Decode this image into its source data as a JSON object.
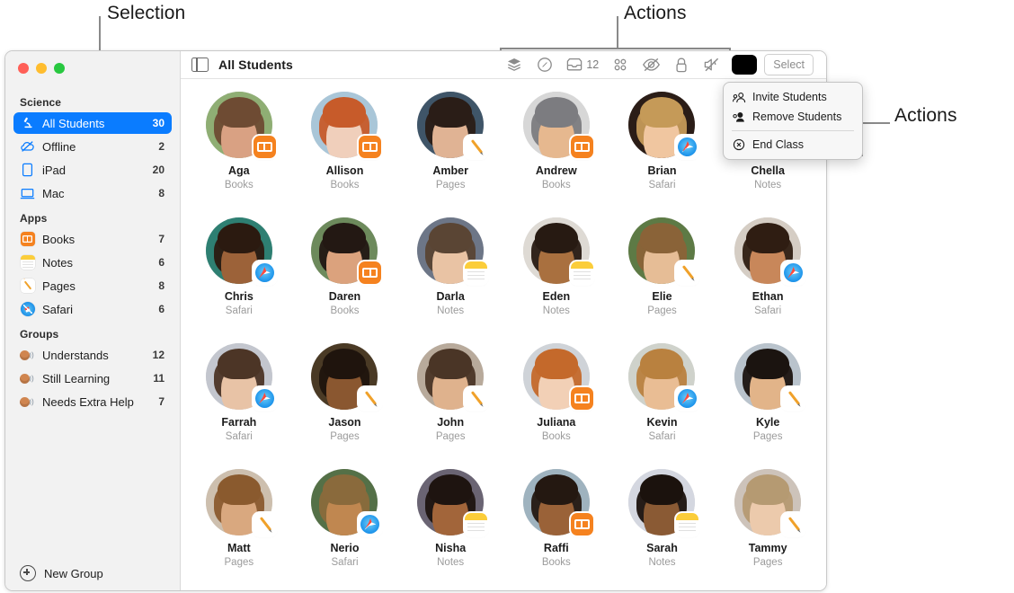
{
  "annotations": [
    {
      "id": "selection",
      "label": "Selection"
    },
    {
      "id": "actions_top",
      "label": "Actions"
    },
    {
      "id": "actions_right",
      "label": "Actions"
    }
  ],
  "window": {
    "traffic_lights": [
      "close",
      "minimize",
      "zoom"
    ],
    "toolbar": {
      "sidebar_toggle_icon": "sidebar-toggle-icon",
      "title": "All Students",
      "icons": [
        {
          "name": "layers-icon",
          "label": "Layers"
        },
        {
          "name": "navigate-icon",
          "label": "Navigate"
        },
        {
          "name": "inbox-icon",
          "label": "Inbox",
          "count": "12"
        },
        {
          "name": "grid-apps-icon",
          "label": "Apps"
        },
        {
          "name": "hide-screen-icon",
          "label": "Hide Screen"
        },
        {
          "name": "lock-icon",
          "label": "Lock"
        },
        {
          "name": "mute-icon",
          "label": "Mute"
        }
      ],
      "color_swatch": "#000000",
      "select_label": "Select"
    }
  },
  "sidebar": {
    "sections": [
      {
        "title": "Science",
        "items": [
          {
            "label": "All Students",
            "count": "30",
            "icon": "microscope-icon",
            "selected": true
          },
          {
            "label": "Offline",
            "count": "2",
            "icon": "offline-cloud-icon",
            "selected": false
          },
          {
            "label": "iPad",
            "count": "20",
            "icon": "ipad-icon",
            "selected": false
          },
          {
            "label": "Mac",
            "count": "8",
            "icon": "mac-icon",
            "selected": false
          }
        ]
      },
      {
        "title": "Apps",
        "items": [
          {
            "label": "Books",
            "count": "7",
            "icon": "books-app-icon",
            "selected": false
          },
          {
            "label": "Notes",
            "count": "6",
            "icon": "notes-app-icon",
            "selected": false
          },
          {
            "label": "Pages",
            "count": "8",
            "icon": "pages-app-icon",
            "selected": false
          },
          {
            "label": "Safari",
            "count": "6",
            "icon": "safari-app-icon",
            "selected": false
          }
        ]
      },
      {
        "title": "Groups",
        "items": [
          {
            "label": "Understands",
            "count": "12",
            "icon": "group-icon",
            "selected": false
          },
          {
            "label": "Still Learning",
            "count": "11",
            "icon": "group-icon",
            "selected": false
          },
          {
            "label": "Needs Extra Help",
            "count": "7",
            "icon": "group-icon",
            "selected": false
          }
        ]
      }
    ],
    "new_group_label": "New Group"
  },
  "actions_menu": {
    "items": [
      {
        "label": "Invite Students",
        "icon": "invite-person-icon"
      },
      {
        "label": "Remove Students",
        "icon": "remove-person-icon"
      },
      {
        "label": "End Class",
        "icon": "end-class-icon"
      }
    ]
  },
  "students": [
    {
      "name": "Aga",
      "app": "Books",
      "badge": "b-books",
      "skin": "#d9a183",
      "hair": "#6e4b33",
      "bg": "#8fae74"
    },
    {
      "name": "Allison",
      "app": "Books",
      "badge": "b-books",
      "skin": "#f0cfbb",
      "hair": "#c75b2a",
      "bg": "#a9c6d8"
    },
    {
      "name": "Amber",
      "app": "Pages",
      "badge": "b-pages",
      "skin": "#e0b394",
      "hair": "#2a1d17",
      "bg": "#3f5568"
    },
    {
      "name": "Andrew",
      "app": "Books",
      "badge": "b-books",
      "skin": "#e6b88f",
      "hair": "#7c7c80",
      "bg": "#d7d7d7"
    },
    {
      "name": "Brian",
      "app": "Safari",
      "badge": "b-safari",
      "skin": "#f0c6a0",
      "hair": "#c59a58",
      "bg": "#2b1d17"
    },
    {
      "name": "Chella",
      "app": "Notes",
      "badge": "b-notes",
      "skin": "#c98c5e",
      "hair": "#3a2419",
      "bg": "#c8a477"
    },
    {
      "name": "Chris",
      "app": "Safari",
      "badge": "b-safari",
      "skin": "#9c6239",
      "hair": "#2b1a10",
      "bg": "#2e7f72"
    },
    {
      "name": "Daren",
      "app": "Books",
      "badge": "b-books",
      "skin": "#dba27d",
      "hair": "#231813",
      "bg": "#6d8a5c"
    },
    {
      "name": "Darla",
      "app": "Notes",
      "badge": "b-notes",
      "skin": "#e9c3a4",
      "hair": "#5a4534",
      "bg": "#6d7687"
    },
    {
      "name": "Eden",
      "app": "Notes",
      "badge": "b-notes",
      "skin": "#a9703f",
      "hair": "#271a12",
      "bg": "#dedad4"
    },
    {
      "name": "Elie",
      "app": "Pages",
      "badge": "b-pages",
      "skin": "#e6bd96",
      "hair": "#8a6338",
      "bg": "#5d7a45"
    },
    {
      "name": "Ethan",
      "app": "Safari",
      "badge": "b-safari",
      "skin": "#c8875a",
      "hair": "#2f1d12",
      "bg": "#d5cdc4"
    },
    {
      "name": "Farrah",
      "app": "Safari",
      "badge": "b-safari",
      "skin": "#e8c3a6",
      "hair": "#4c3526",
      "bg": "#c3c6ce"
    },
    {
      "name": "Jason",
      "app": "Pages",
      "badge": "b-pages",
      "skin": "#8a5730",
      "hair": "#1f140d",
      "bg": "#4a3a25"
    },
    {
      "name": "John",
      "app": "Pages",
      "badge": "b-pages",
      "skin": "#dfb28d",
      "hair": "#4a3526",
      "bg": "#b8aa9b"
    },
    {
      "name": "Juliana",
      "app": "Books",
      "badge": "b-books",
      "skin": "#f2d0b6",
      "hair": "#c4692b",
      "bg": "#cfd3d8"
    },
    {
      "name": "Kevin",
      "app": "Safari",
      "badge": "b-safari",
      "skin": "#e9bd94",
      "hair": "#b9813f",
      "bg": "#cfd2cb"
    },
    {
      "name": "Kyle",
      "app": "Pages",
      "badge": "b-pages",
      "skin": "#e2b489",
      "hair": "#1b1410",
      "bg": "#b9c3cc"
    },
    {
      "name": "Matt",
      "app": "Pages",
      "badge": "b-pages",
      "skin": "#d9a87f",
      "hair": "#8a5a2e",
      "bg": "#cdbfae"
    },
    {
      "name": "Nerio",
      "app": "Safari",
      "badge": "b-safari",
      "skin": "#c08750",
      "hair": "#8a6a3c",
      "bg": "#547047"
    },
    {
      "name": "Nisha",
      "app": "Notes",
      "badge": "b-notes",
      "skin": "#a2653a",
      "hair": "#1e1410",
      "bg": "#6a6473"
    },
    {
      "name": "Raffi",
      "app": "Books",
      "badge": "b-books",
      "skin": "#9a6238",
      "hair": "#241811",
      "bg": "#9fb3bf"
    },
    {
      "name": "Sarah",
      "app": "Notes",
      "badge": "b-notes",
      "skin": "#8a5a34",
      "hair": "#1b120d",
      "bg": "#d4d7e0"
    },
    {
      "name": "Tammy",
      "app": "Pages",
      "badge": "b-pages",
      "skin": "#eccaac",
      "hair": "#b59a72",
      "bg": "#cdc3ba"
    }
  ]
}
